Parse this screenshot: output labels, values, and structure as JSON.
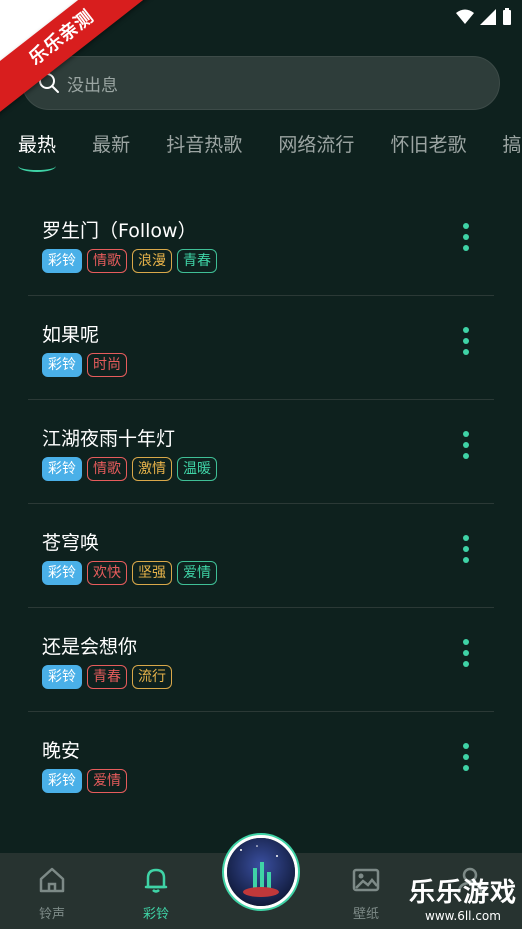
{
  "corner_badge": "乐乐亲测",
  "search": {
    "placeholder": "没出息"
  },
  "tabs": [
    {
      "label": "最热",
      "active": true
    },
    {
      "label": "最新",
      "active": false
    },
    {
      "label": "抖音热歌",
      "active": false
    },
    {
      "label": "网络流行",
      "active": false
    },
    {
      "label": "怀旧老歌",
      "active": false
    },
    {
      "label": "搞笑",
      "active": false
    }
  ],
  "songs": [
    {
      "title": "罗生门（Follow）",
      "tags": [
        {
          "text": "彩铃",
          "style": "ringtone"
        },
        {
          "text": "情歌",
          "style": "red"
        },
        {
          "text": "浪漫",
          "style": "yellow"
        },
        {
          "text": "青春",
          "style": "green"
        }
      ]
    },
    {
      "title": "如果呢",
      "tags": [
        {
          "text": "彩铃",
          "style": "ringtone"
        },
        {
          "text": "时尚",
          "style": "red"
        }
      ]
    },
    {
      "title": "江湖夜雨十年灯",
      "tags": [
        {
          "text": "彩铃",
          "style": "ringtone"
        },
        {
          "text": "情歌",
          "style": "red"
        },
        {
          "text": "激情",
          "style": "yellow"
        },
        {
          "text": "温暖",
          "style": "green"
        }
      ]
    },
    {
      "title": "苍穹唤",
      "tags": [
        {
          "text": "彩铃",
          "style": "ringtone"
        },
        {
          "text": "欢快",
          "style": "red"
        },
        {
          "text": "坚强",
          "style": "yellow"
        },
        {
          "text": "爱情",
          "style": "green"
        }
      ]
    },
    {
      "title": "还是会想你",
      "tags": [
        {
          "text": "彩铃",
          "style": "ringtone"
        },
        {
          "text": "青春",
          "style": "red"
        },
        {
          "text": "流行",
          "style": "yellow"
        }
      ]
    },
    {
      "title": "晚安",
      "tags": [
        {
          "text": "彩铃",
          "style": "ringtone"
        },
        {
          "text": "爱情",
          "style": "red"
        }
      ]
    }
  ],
  "bottom_nav": [
    {
      "label": "铃声",
      "icon": "home-icon",
      "active": false
    },
    {
      "label": "彩铃",
      "icon": "bell-icon",
      "active": true
    },
    {
      "label": "壁纸",
      "icon": "image-icon",
      "active": false
    },
    {
      "label": "",
      "icon": "user-icon",
      "active": false
    }
  ],
  "watermark": {
    "main": "乐乐游戏",
    "sub": "www.6ll.com"
  },
  "colors": {
    "accent": "#3fd3a6",
    "background": "#0e211e",
    "ringtone_tag": "#4ab0e8",
    "red_tag": "#e65c5c",
    "yellow_tag": "#e6b24a"
  }
}
